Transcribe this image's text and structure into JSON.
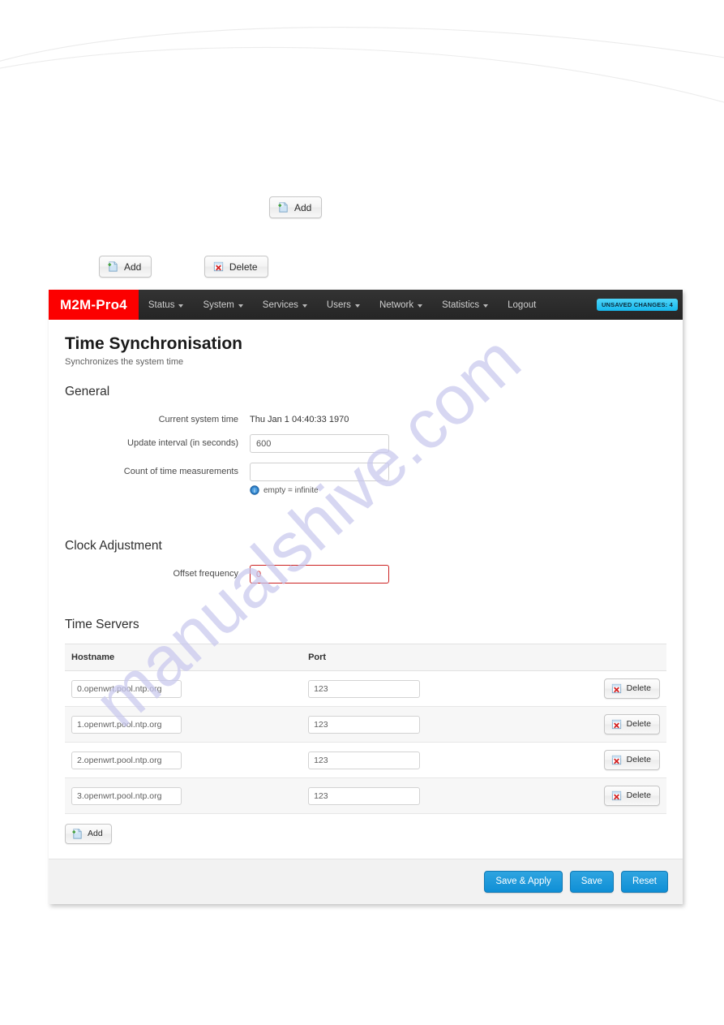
{
  "doc_buttons": {
    "top_single": {
      "label": "Add",
      "icon": "add-page-icon"
    },
    "pair": [
      {
        "label": "Add",
        "icon": "add-page-icon"
      },
      {
        "label": "Delete",
        "icon": "delete-page-icon"
      }
    ]
  },
  "watermark": {
    "text": "manualshive.com"
  },
  "navbar": {
    "brand": "M2M-Pro4",
    "items": [
      {
        "label": "Status",
        "caret": true
      },
      {
        "label": "System",
        "caret": true
      },
      {
        "label": "Services",
        "caret": true
      },
      {
        "label": "Users",
        "caret": true
      },
      {
        "label": "Network",
        "caret": true
      },
      {
        "label": "Statistics",
        "caret": true
      },
      {
        "label": "Logout",
        "caret": false
      }
    ],
    "unsaved_badge": "UNSAVED CHANGES: 4",
    "brand_color": "#fc0000",
    "badge_color": "#32c8f4"
  },
  "page": {
    "title": "Time Synchronisation",
    "subtitle": "Synchronizes the system time"
  },
  "general": {
    "heading": "General",
    "current_system_time": {
      "label": "Current system time",
      "value": "Thu Jan 1 04:40:33 1970"
    },
    "update_interval": {
      "label": "Update interval (in seconds)",
      "value": "600",
      "placeholder": ""
    },
    "count_measurements": {
      "label": "Count of time measurements",
      "value": "",
      "placeholder": "",
      "hint": "empty = infinite",
      "hint_icon": "info-icon"
    }
  },
  "clock_adjustment": {
    "heading": "Clock Adjustment",
    "offset_frequency": {
      "label": "Offset frequency",
      "value": "0",
      "error": true,
      "error_color": "#cc2222"
    }
  },
  "time_servers": {
    "heading": "Time Servers",
    "columns": [
      "Hostname",
      "Port"
    ],
    "rows": [
      {
        "hostname": "0.openwrt.pool.ntp.org",
        "port": "123",
        "delete_label": "Delete"
      },
      {
        "hostname": "1.openwrt.pool.ntp.org",
        "port": "123",
        "delete_label": "Delete"
      },
      {
        "hostname": "2.openwrt.pool.ntp.org",
        "port": "123",
        "delete_label": "Delete"
      },
      {
        "hostname": "3.openwrt.pool.ntp.org",
        "port": "123",
        "delete_label": "Delete"
      }
    ],
    "add_label": "Add"
  },
  "footer": {
    "save_apply_label": "Save & Apply",
    "save_label": "Save",
    "reset_label": "Reset",
    "button_color": "#0f8fd6"
  }
}
